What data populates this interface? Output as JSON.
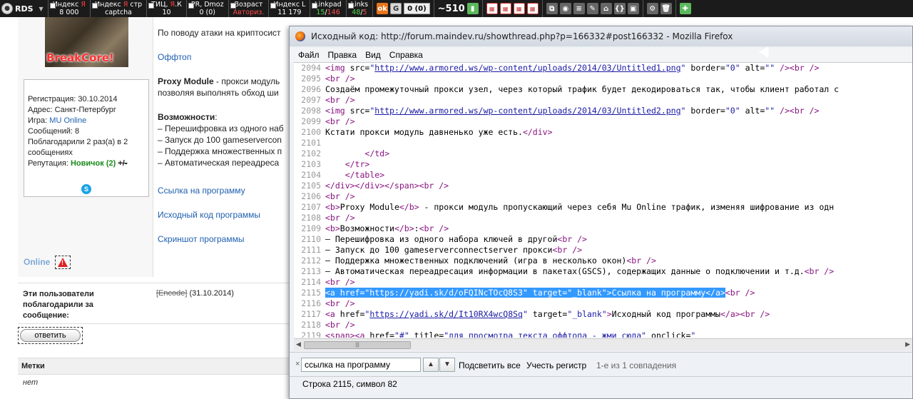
{
  "toolbar": {
    "logo": "RDS",
    "stats": [
      {
        "label_pre": "Индекс ",
        "label_ya": "Я",
        "value": "8 000",
        "value_class": ""
      },
      {
        "label_pre": "Индекс ",
        "label_ya": "Я",
        "label_post": " стр",
        "value": "captcha",
        "value_class": ""
      },
      {
        "label_pre": "ТИЦ, ",
        "label_ya": "Я",
        "label_post": ".К",
        "value": "10",
        "value_class": ""
      },
      {
        "label_pre": "PR, Dmoz",
        "value": "0 (0)",
        "value_class": ""
      },
      {
        "label_pre": "Возраст",
        "value": "Авториз.",
        "value_class": "red"
      },
      {
        "label_pre": "Индекс L",
        "value": "11 179",
        "value_class": ""
      },
      {
        "label_pre": "Linkpad",
        "value_g": "15",
        "value_r": "146"
      },
      {
        "label_pre": "Links",
        "value_g": "48",
        "value_r": "5"
      }
    ],
    "counter": "0 (0)",
    "rank": "~510"
  },
  "forum": {
    "avatar_text": "BreakCore!",
    "profile": {
      "registration": "Регистрация: 30.10.2014",
      "address": "Адрес: Санкт-Петербург",
      "game_label": "Игра: ",
      "game_value": "MU Online",
      "messages": "Сообщений: 8",
      "thanked_line1": "Поблагодарили 2 раз(а) в 2",
      "thanked_line2": "сообщениях",
      "reputation_label": "Репутация: ",
      "reputation_value": "Новичок (2)",
      "reputation_pm": "+/-"
    },
    "online": "Online",
    "post": {
      "line_attack": "По поводу атаки на криптосист",
      "offtop": "Оффтоп",
      "proxy_bold": "Proxy Module",
      "proxy_rest": " - прокси модуль",
      "proxy_line2": "позволяя выполнять обход ши",
      "features": "Возможности",
      "features_colon": ":",
      "feat1": "– Перешифровка из одного наб",
      "feat2": "– Запуск до 100 gameservercon",
      "feat3": "– Поддержка множественных п",
      "feat4": "– Автоматическая переадреса",
      "link1": "Ссылка на программу",
      "link2": "Исходный код программы",
      "link3": "Скриншот программы"
    },
    "thanks_label": "Эти пользователи поблагодарили за сообщение:",
    "thanks_user": "[Encode]",
    "thanks_date": " (31.10.2014)",
    "reply_button": "ответить",
    "tags_label": "Метки",
    "tags_value": "нет"
  },
  "firefox": {
    "title": "Исходный код: http://forum.maindev.ru/showthread.php?p=166332#post166332 - Mozilla Firefox",
    "menu": [
      "Файл",
      "Правка",
      "Вид",
      "Справка"
    ],
    "find_value": "ссылка на программу",
    "highlight_all": "Подсветить все",
    "match_case": "Учесть регистр",
    "find_status": "1-е из 1 совпадения",
    "status": "Строка 2115, символ 82",
    "lines": [
      {
        "n": "2094",
        "segs": [
          [
            "tag",
            "<img "
          ],
          [
            "att",
            "src="
          ],
          [
            "str",
            "\""
          ],
          [
            "lnk",
            "http://www.armored.ws/wp-content/uploads/2014/03/Untitled1.png"
          ],
          [
            "str",
            "\""
          ],
          [
            "att",
            " border="
          ],
          [
            "str",
            "\"0\""
          ],
          [
            "att",
            " alt="
          ],
          [
            "str",
            "\"\""
          ],
          [
            "tag",
            " /><br />"
          ]
        ]
      },
      {
        "n": "2095",
        "segs": [
          [
            "tag",
            "<br />"
          ]
        ]
      },
      {
        "n": "2096",
        "segs": [
          [
            "att",
            "Создаём промежуточный прокси узел, через который трафик будет декодироваться так, чтобы клиент работал с"
          ]
        ]
      },
      {
        "n": "2097",
        "segs": [
          [
            "tag",
            "<br />"
          ]
        ]
      },
      {
        "n": "2098",
        "segs": [
          [
            "tag",
            "<img "
          ],
          [
            "att",
            "src="
          ],
          [
            "str",
            "\""
          ],
          [
            "lnk",
            "http://www.armored.ws/wp-content/uploads/2014/03/Untitled2.png"
          ],
          [
            "str",
            "\""
          ],
          [
            "att",
            " border="
          ],
          [
            "str",
            "\"0\""
          ],
          [
            "att",
            " alt="
          ],
          [
            "str",
            "\"\""
          ],
          [
            "tag",
            " /><br />"
          ]
        ]
      },
      {
        "n": "2099",
        "segs": [
          [
            "tag",
            "<br />"
          ]
        ]
      },
      {
        "n": "2100",
        "segs": [
          [
            "att",
            "Кстати прокси модуль давненько уже есть."
          ],
          [
            "tag",
            "</div>"
          ]
        ]
      },
      {
        "n": "2101",
        "segs": []
      },
      {
        "n": "2102",
        "segs": [
          [
            "att",
            "        "
          ],
          [
            "tag",
            "</td>"
          ]
        ]
      },
      {
        "n": "2103",
        "segs": [
          [
            "att",
            "    "
          ],
          [
            "tag",
            "</tr>"
          ]
        ]
      },
      {
        "n": "2104",
        "segs": [
          [
            "att",
            "    "
          ],
          [
            "tag",
            "</table>"
          ]
        ]
      },
      {
        "n": "2105",
        "segs": [
          [
            "tag",
            "</div></div></span><br />"
          ]
        ]
      },
      {
        "n": "2106",
        "segs": [
          [
            "tag",
            "<br />"
          ]
        ]
      },
      {
        "n": "2107",
        "segs": [
          [
            "tag",
            "<b>"
          ],
          [
            "att",
            "Proxy Module"
          ],
          [
            "tag",
            "</b>"
          ],
          [
            "att",
            " - прокси модуль пропускающий через себя Mu Online трафик, изменяя шифрование из одн"
          ]
        ]
      },
      {
        "n": "2108",
        "segs": [
          [
            "tag",
            "<br />"
          ]
        ]
      },
      {
        "n": "2109",
        "segs": [
          [
            "tag",
            "<b>"
          ],
          [
            "att",
            "Возможности"
          ],
          [
            "tag",
            "</b>"
          ],
          [
            "att",
            ":"
          ],
          [
            "tag",
            "<br />"
          ]
        ]
      },
      {
        "n": "2110",
        "segs": [
          [
            "att",
            "– Перешифровка из одного набора ключей в другой"
          ],
          [
            "tag",
            "<br />"
          ]
        ]
      },
      {
        "n": "2111",
        "segs": [
          [
            "att",
            "– Запуск до 100 gameserverconnectserver прокси"
          ],
          [
            "tag",
            "<br />"
          ]
        ]
      },
      {
        "n": "2112",
        "segs": [
          [
            "att",
            "– Поддержка множественных подключений (игра в несколько окон)"
          ],
          [
            "tag",
            "<br />"
          ]
        ]
      },
      {
        "n": "2113",
        "segs": [
          [
            "att",
            "– Автоматическая переадресация информации в пакетах(GSCS), содержащих данные о подключении и т.д."
          ],
          [
            "tag",
            "<br />"
          ]
        ]
      },
      {
        "n": "2114",
        "segs": [
          [
            "tag",
            "<br />"
          ]
        ]
      },
      {
        "n": "2115",
        "segs": [
          [
            "sel",
            "<a href=\"https://yadi.sk/d/oFQINcTOcQ8S3\" target=\"_blank\">Ссылка на программу</a>"
          ],
          [
            "tag",
            "<br />"
          ]
        ]
      },
      {
        "n": "2116",
        "segs": [
          [
            "tag",
            "<br />"
          ]
        ]
      },
      {
        "n": "2117",
        "segs": [
          [
            "tag",
            "<a "
          ],
          [
            "att",
            "href="
          ],
          [
            "str",
            "\""
          ],
          [
            "lnk",
            "https://yadi.sk/d/It10RX4wcQ8Sq"
          ],
          [
            "str",
            "\""
          ],
          [
            "att",
            " target="
          ],
          [
            "str",
            "\"_blank\""
          ],
          [
            "tag",
            ">"
          ],
          [
            "att",
            "Исходный код программы"
          ],
          [
            "tag",
            "</a><br />"
          ]
        ]
      },
      {
        "n": "2118",
        "segs": [
          [
            "tag",
            "<br />"
          ]
        ]
      },
      {
        "n": "2119",
        "segs": [
          [
            "tag",
            "<span><a "
          ],
          [
            "att",
            "href="
          ],
          [
            "str",
            "\""
          ],
          [
            "lnk",
            "#"
          ],
          [
            "str",
            "\""
          ],
          [
            "att",
            " title="
          ],
          [
            "str",
            "\"для просмотра текста оффтопа - жми сюда\""
          ],
          [
            "att",
            " onclick="
          ],
          [
            "str",
            "\""
          ]
        ]
      }
    ]
  }
}
